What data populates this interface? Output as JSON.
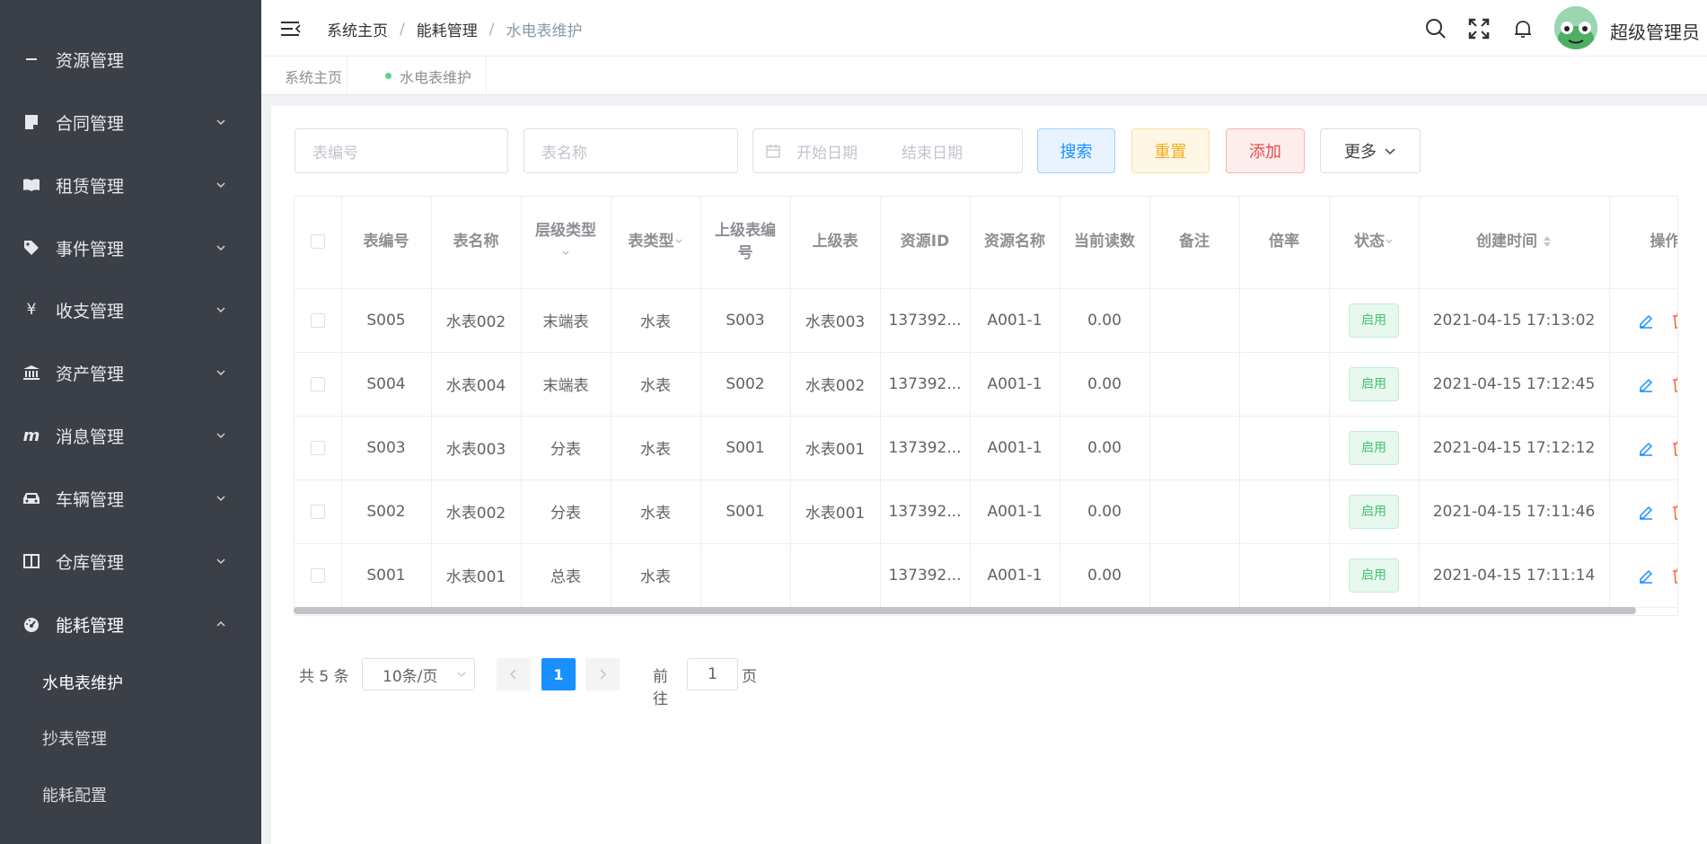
{
  "sidebar": {
    "items": [
      {
        "label": "资源管理",
        "icon": "minus-icon"
      },
      {
        "label": "合同管理",
        "icon": "document-icon"
      },
      {
        "label": "租赁管理",
        "icon": "book-icon"
      },
      {
        "label": "事件管理",
        "icon": "tag-icon"
      },
      {
        "label": "收支管理",
        "icon": "yen-icon"
      },
      {
        "label": "资产管理",
        "icon": "bank-icon"
      },
      {
        "label": "消息管理",
        "icon": "message-icon"
      },
      {
        "label": "车辆管理",
        "icon": "car-icon"
      },
      {
        "label": "仓库管理",
        "icon": "warehouse-icon"
      },
      {
        "label": "能耗管理",
        "icon": "dashboard-icon"
      }
    ],
    "subitems": [
      {
        "label": "水电表维护"
      },
      {
        "label": "抄表管理"
      },
      {
        "label": "能耗配置"
      }
    ]
  },
  "header": {
    "breadcrumb": [
      "系统主页",
      "能耗管理",
      "水电表维护"
    ],
    "separator": "/",
    "username": "超级管理员"
  },
  "tags": [
    {
      "label": "系统主页"
    },
    {
      "label": "水电表维护"
    }
  ],
  "filters": {
    "code_placeholder": "表编号",
    "name_placeholder": "表名称",
    "start_placeholder": "开始日期",
    "end_placeholder": "结束日期",
    "search_label": "搜索",
    "reset_label": "重置",
    "add_label": "添加",
    "more_label": "更多"
  },
  "table": {
    "headers": [
      "表编号",
      "表名称",
      "层级类型",
      "表类型",
      "上级表编号",
      "上级表",
      "资源ID",
      "资源名称",
      "当前读数",
      "备注",
      "倍率",
      "状态",
      "创建时间",
      "操作"
    ],
    "rows": [
      {
        "code": "S005",
        "name": "水表002",
        "level": "末端表",
        "type": "水表",
        "parent_code": "S003",
        "parent": "水表003",
        "res_id": "137392...",
        "res_name": "A001-1",
        "reading": "0.00",
        "remark": "",
        "rate": "",
        "status": "启用",
        "created": "2021-04-15 17:13:02"
      },
      {
        "code": "S004",
        "name": "水表004",
        "level": "末端表",
        "type": "水表",
        "parent_code": "S002",
        "parent": "水表002",
        "res_id": "137392...",
        "res_name": "A001-1",
        "reading": "0.00",
        "remark": "",
        "rate": "",
        "status": "启用",
        "created": "2021-04-15 17:12:45"
      },
      {
        "code": "S003",
        "name": "水表003",
        "level": "分表",
        "type": "水表",
        "parent_code": "S001",
        "parent": "水表001",
        "res_id": "137392...",
        "res_name": "A001-1",
        "reading": "0.00",
        "remark": "",
        "rate": "",
        "status": "启用",
        "created": "2021-04-15 17:12:12"
      },
      {
        "code": "S002",
        "name": "水表002",
        "level": "分表",
        "type": "水表",
        "parent_code": "S001",
        "parent": "水表001",
        "res_id": "137392...",
        "res_name": "A001-1",
        "reading": "0.00",
        "remark": "",
        "rate": "",
        "status": "启用",
        "created": "2021-04-15 17:11:46"
      },
      {
        "code": "S001",
        "name": "水表001",
        "level": "总表",
        "type": "水表",
        "parent_code": "",
        "parent": "",
        "res_id": "137392...",
        "res_name": "A001-1",
        "reading": "0.00",
        "remark": "",
        "rate": "",
        "status": "启用",
        "created": "2021-04-15 17:11:14"
      }
    ]
  },
  "pagination": {
    "total_text": "共 5 条",
    "page_size": "10条/页",
    "current_page": "1",
    "goto_label": "前往",
    "goto_value": "1",
    "page_label": "页"
  },
  "colors": {
    "sidebar_bg": "#3b3f48",
    "primary": "#1890ff",
    "success": "#43c16f",
    "warning": "#f6ad1d",
    "danger": "#e84c4c"
  }
}
